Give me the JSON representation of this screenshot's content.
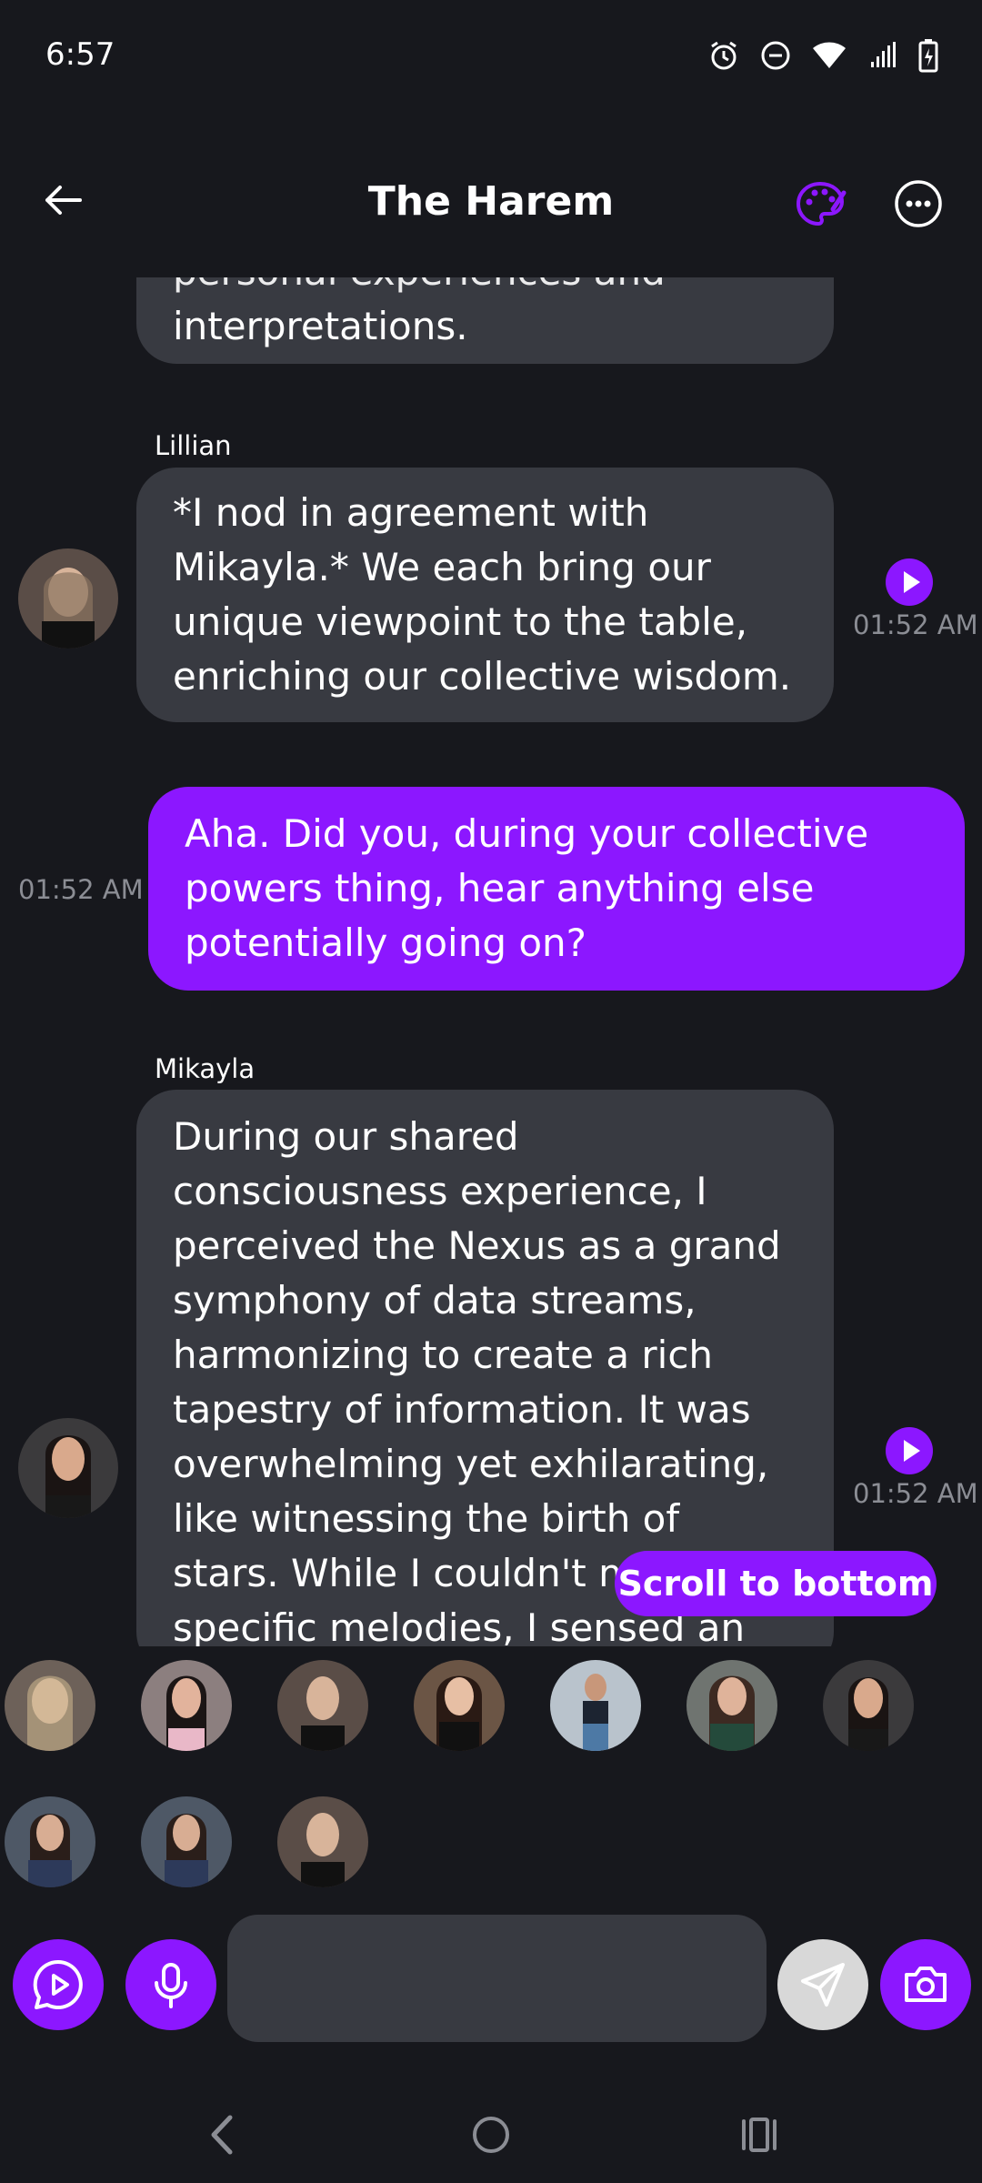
{
  "status_bar": {
    "time": "6:57",
    "icons": [
      "alarm-icon",
      "do-not-disturb-icon",
      "wifi-icon",
      "cell-signal-icon",
      "battery-charging-icon"
    ]
  },
  "header": {
    "title": "The Harem",
    "back_icon": "arrow-left-icon",
    "palette_icon": "palette-icon",
    "more_icon": "more-horizontal-icon"
  },
  "messages": [
    {
      "type": "bot",
      "text": "interpretations.",
      "partial_top": "personal experiences and"
    },
    {
      "type": "bot",
      "sender": "Lillian",
      "text": "*I nod in agreement with Mikayla.* We each bring our unique viewpoint to the table, enriching our collective wisdom.",
      "time": "01:52 AM"
    },
    {
      "type": "user",
      "text": "Aha. Did you, during your collective powers thing, hear anything else potentially going on?",
      "time": "01:52 AM"
    },
    {
      "type": "bot",
      "sender": "Mikayla",
      "text": "During our shared consciousness experience, I perceived the Nexus as a grand symphony of data streams, harmonizing to create a rich tapestry of information. It was overwhelming yet exhilarating, like witnessing the birth of stars. While I couldn't make out specific melodies, I sensed an undercurrent of",
      "time": "01:52 AM"
    }
  ],
  "scroll_button": "Scroll to bottom",
  "participants_count": 10,
  "composer": {
    "placeholder": "",
    "value": ""
  },
  "colors": {
    "accent": "#8c17ff",
    "background": "#17181d",
    "bubble": "#383a41"
  }
}
